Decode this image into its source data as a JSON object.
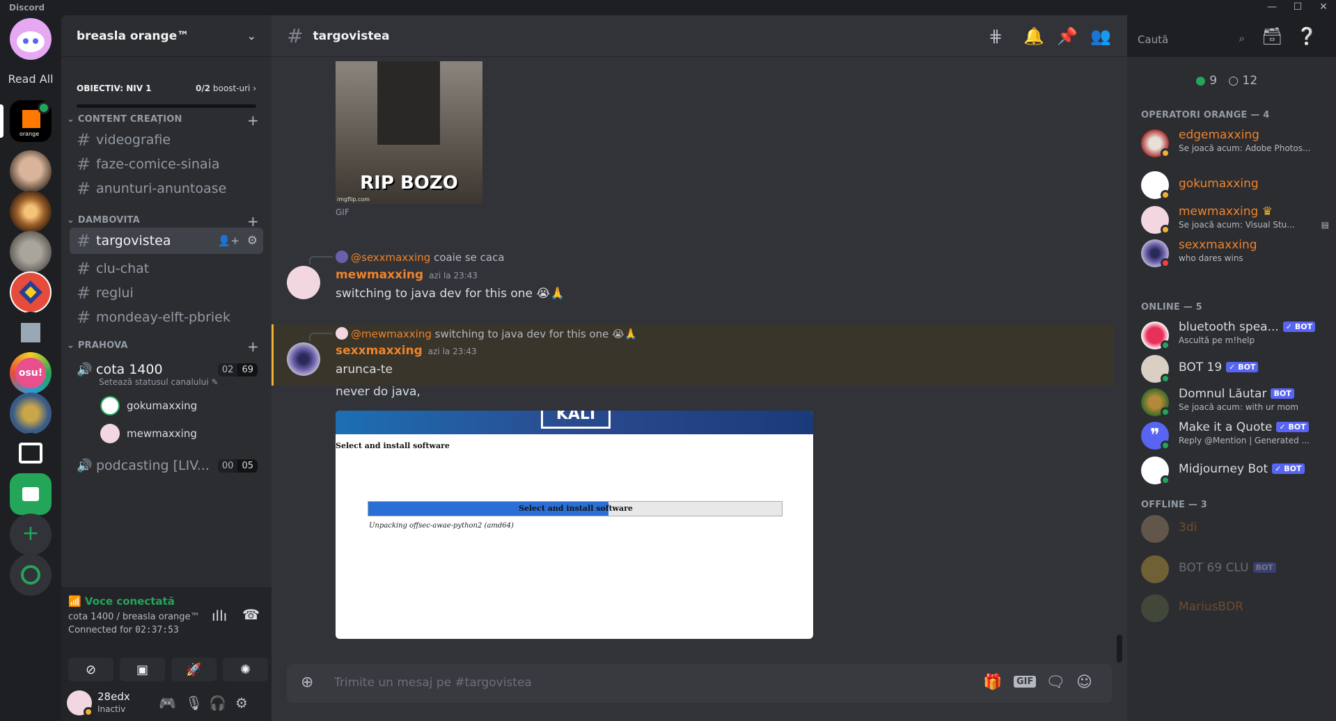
{
  "titlebar": {
    "app_name": "Discord",
    "min": "—",
    "max": "☐",
    "close": "✕"
  },
  "rail": {
    "read_all": "Read All",
    "osu_label": "osu!",
    "add": "+"
  },
  "guild": {
    "name": "breasla orange™",
    "boost_goal": "OBIECTIV: NIV 1",
    "boost_count": "0/2",
    "boost_suffix": " boost-uri",
    "categories": [
      "CONTENT CREAȚION",
      "DAMBOVITA",
      "PRAHOVA"
    ],
    "channels_content": [
      "videografie",
      "faze-comice-sinaia",
      "anunturi-anuntoase"
    ],
    "channels_dambovita": [
      "targovistea",
      "clu-chat",
      "reglui",
      "mondeay-elft-pbriek"
    ],
    "voice": [
      {
        "name": "cota 1400",
        "count_a": "02",
        "count_b": "69",
        "status": "Setează statusul canalului"
      },
      {
        "name": "podcasting [LIV...",
        "count_a": "00",
        "count_b": "05"
      }
    ],
    "voice_users": [
      "gokumaxxing",
      "mewmaxxing"
    ]
  },
  "voice_panel": {
    "status": "Voce conectată",
    "location": "cota 1400 / breasla orange™",
    "connected_label": "Connected for",
    "connected_time": "02:37:53"
  },
  "user": {
    "name": "28edx",
    "status": "Inactiv"
  },
  "chat": {
    "channel": "targovistea",
    "search_placeholder": "Caută",
    "gif_overlay": "RIP BOZO",
    "gif_watermark": "imgflip.com",
    "gif_label": "GIF",
    "messages": [
      {
        "reply_mention": "@sexxmaxxing",
        "reply_text": "coaie se caca",
        "author": "mewmaxxing",
        "time": "azi la 23:43",
        "text": "switching to java dev for this one 😭🙏"
      },
      {
        "reply_mention": "@mewmaxxing",
        "reply_text": "switching to java dev for this one 😭🙏",
        "author": "sexxmaxxing",
        "time": "azi la 23:43",
        "text": "arunca-te",
        "text2": "never do java,"
      }
    ],
    "kali": {
      "logo": "KALI",
      "heading": "Select and install software",
      "bar_label": "Select and install software",
      "progress": 0.58,
      "detail": "Unpacking offsec-awae-python2 (amd64)"
    },
    "composer_placeholder": "Trimite un mesaj pe #targovistea"
  },
  "members": {
    "online_count": "9",
    "offline_count": "12",
    "groups": [
      {
        "title": "OPERATORI ORANGE — 4"
      },
      {
        "title": "ONLINE — 5"
      },
      {
        "title": "OFFLINE — 3"
      }
    ],
    "operators": [
      {
        "name": "edgemaxxing",
        "status": "Se joacă acum: Adobe Photos..."
      },
      {
        "name": "gokumaxxing",
        "status": ""
      },
      {
        "name": "mewmaxxing",
        "status": "Se joacă acum: Visual Stu..."
      },
      {
        "name": "sexxmaxxing",
        "status": "who dares wins"
      }
    ],
    "online": [
      {
        "name": "bluetooth spea...",
        "status": "Ascultă pe m!help",
        "badge": "✓ BOT"
      },
      {
        "name": "BOT 19",
        "status": "",
        "badge": "✓ BOT"
      },
      {
        "name": "Domnul Lăutar",
        "status": "Se joacă acum: with ur mom",
        "badge": "BOT"
      },
      {
        "name": "Make it a Quote",
        "status": "Reply @Mention | Generated ...",
        "badge": "✓ BOT"
      },
      {
        "name": "Midjourney Bot",
        "status": "",
        "badge": "✓ BOT"
      }
    ],
    "offline": [
      {
        "name": "3di",
        "badge": ""
      },
      {
        "name": "BOT 69 CLU",
        "badge": "BOT"
      },
      {
        "name": "MariusBDR",
        "badge": ""
      }
    ]
  },
  "colors": {
    "accent": "#f0832a",
    "online": "#23a55a",
    "idle": "#f0b232",
    "dnd": "#f23f43",
    "blurple": "#5865f2"
  }
}
